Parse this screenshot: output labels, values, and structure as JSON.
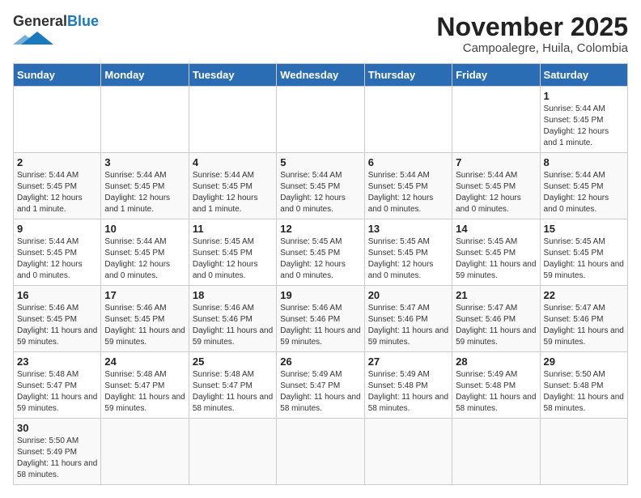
{
  "header": {
    "logo_general": "General",
    "logo_blue": "Blue",
    "month_title": "November 2025",
    "location": "Campoalegre, Huila, Colombia"
  },
  "weekdays": [
    "Sunday",
    "Monday",
    "Tuesday",
    "Wednesday",
    "Thursday",
    "Friday",
    "Saturday"
  ],
  "weeks": [
    [
      {
        "day": "",
        "info": "",
        "empty": true
      },
      {
        "day": "",
        "info": "",
        "empty": true
      },
      {
        "day": "",
        "info": "",
        "empty": true
      },
      {
        "day": "",
        "info": "",
        "empty": true
      },
      {
        "day": "",
        "info": "",
        "empty": true
      },
      {
        "day": "",
        "info": "",
        "empty": true
      },
      {
        "day": "1",
        "info": "Sunrise: 5:44 AM\nSunset: 5:45 PM\nDaylight: 12 hours\nand 1 minute.",
        "empty": false
      }
    ],
    [
      {
        "day": "2",
        "info": "Sunrise: 5:44 AM\nSunset: 5:45 PM\nDaylight: 12 hours\nand 1 minute.",
        "empty": false
      },
      {
        "day": "3",
        "info": "Sunrise: 5:44 AM\nSunset: 5:45 PM\nDaylight: 12 hours\nand 1 minute.",
        "empty": false
      },
      {
        "day": "4",
        "info": "Sunrise: 5:44 AM\nSunset: 5:45 PM\nDaylight: 12 hours\nand 1 minute.",
        "empty": false
      },
      {
        "day": "5",
        "info": "Sunrise: 5:44 AM\nSunset: 5:45 PM\nDaylight: 12 hours\nand 0 minutes.",
        "empty": false
      },
      {
        "day": "6",
        "info": "Sunrise: 5:44 AM\nSunset: 5:45 PM\nDaylight: 12 hours\nand 0 minutes.",
        "empty": false
      },
      {
        "day": "7",
        "info": "Sunrise: 5:44 AM\nSunset: 5:45 PM\nDaylight: 12 hours\nand 0 minutes.",
        "empty": false
      },
      {
        "day": "8",
        "info": "Sunrise: 5:44 AM\nSunset: 5:45 PM\nDaylight: 12 hours\nand 0 minutes.",
        "empty": false
      }
    ],
    [
      {
        "day": "9",
        "info": "Sunrise: 5:44 AM\nSunset: 5:45 PM\nDaylight: 12 hours\nand 0 minutes.",
        "empty": false
      },
      {
        "day": "10",
        "info": "Sunrise: 5:44 AM\nSunset: 5:45 PM\nDaylight: 12 hours\nand 0 minutes.",
        "empty": false
      },
      {
        "day": "11",
        "info": "Sunrise: 5:45 AM\nSunset: 5:45 PM\nDaylight: 12 hours\nand 0 minutes.",
        "empty": false
      },
      {
        "day": "12",
        "info": "Sunrise: 5:45 AM\nSunset: 5:45 PM\nDaylight: 12 hours\nand 0 minutes.",
        "empty": false
      },
      {
        "day": "13",
        "info": "Sunrise: 5:45 AM\nSunset: 5:45 PM\nDaylight: 12 hours\nand 0 minutes.",
        "empty": false
      },
      {
        "day": "14",
        "info": "Sunrise: 5:45 AM\nSunset: 5:45 PM\nDaylight: 11 hours\nand 59 minutes.",
        "empty": false
      },
      {
        "day": "15",
        "info": "Sunrise: 5:45 AM\nSunset: 5:45 PM\nDaylight: 11 hours\nand 59 minutes.",
        "empty": false
      }
    ],
    [
      {
        "day": "16",
        "info": "Sunrise: 5:46 AM\nSunset: 5:45 PM\nDaylight: 11 hours\nand 59 minutes.",
        "empty": false
      },
      {
        "day": "17",
        "info": "Sunrise: 5:46 AM\nSunset: 5:45 PM\nDaylight: 11 hours\nand 59 minutes.",
        "empty": false
      },
      {
        "day": "18",
        "info": "Sunrise: 5:46 AM\nSunset: 5:46 PM\nDaylight: 11 hours\nand 59 minutes.",
        "empty": false
      },
      {
        "day": "19",
        "info": "Sunrise: 5:46 AM\nSunset: 5:46 PM\nDaylight: 11 hours\nand 59 minutes.",
        "empty": false
      },
      {
        "day": "20",
        "info": "Sunrise: 5:47 AM\nSunset: 5:46 PM\nDaylight: 11 hours\nand 59 minutes.",
        "empty": false
      },
      {
        "day": "21",
        "info": "Sunrise: 5:47 AM\nSunset: 5:46 PM\nDaylight: 11 hours\nand 59 minutes.",
        "empty": false
      },
      {
        "day": "22",
        "info": "Sunrise: 5:47 AM\nSunset: 5:46 PM\nDaylight: 11 hours\nand 59 minutes.",
        "empty": false
      }
    ],
    [
      {
        "day": "23",
        "info": "Sunrise: 5:48 AM\nSunset: 5:47 PM\nDaylight: 11 hours\nand 59 minutes.",
        "empty": false
      },
      {
        "day": "24",
        "info": "Sunrise: 5:48 AM\nSunset: 5:47 PM\nDaylight: 11 hours\nand 59 minutes.",
        "empty": false
      },
      {
        "day": "25",
        "info": "Sunrise: 5:48 AM\nSunset: 5:47 PM\nDaylight: 11 hours\nand 58 minutes.",
        "empty": false
      },
      {
        "day": "26",
        "info": "Sunrise: 5:49 AM\nSunset: 5:47 PM\nDaylight: 11 hours\nand 58 minutes.",
        "empty": false
      },
      {
        "day": "27",
        "info": "Sunrise: 5:49 AM\nSunset: 5:48 PM\nDaylight: 11 hours\nand 58 minutes.",
        "empty": false
      },
      {
        "day": "28",
        "info": "Sunrise: 5:49 AM\nSunset: 5:48 PM\nDaylight: 11 hours\nand 58 minutes.",
        "empty": false
      },
      {
        "day": "29",
        "info": "Sunrise: 5:50 AM\nSunset: 5:48 PM\nDaylight: 11 hours\nand 58 minutes.",
        "empty": false
      }
    ],
    [
      {
        "day": "30",
        "info": "Sunrise: 5:50 AM\nSunset: 5:49 PM\nDaylight: 11 hours\nand 58 minutes.",
        "empty": false
      },
      {
        "day": "",
        "info": "",
        "empty": true
      },
      {
        "day": "",
        "info": "",
        "empty": true
      },
      {
        "day": "",
        "info": "",
        "empty": true
      },
      {
        "day": "",
        "info": "",
        "empty": true
      },
      {
        "day": "",
        "info": "",
        "empty": true
      },
      {
        "day": "",
        "info": "",
        "empty": true
      }
    ]
  ]
}
